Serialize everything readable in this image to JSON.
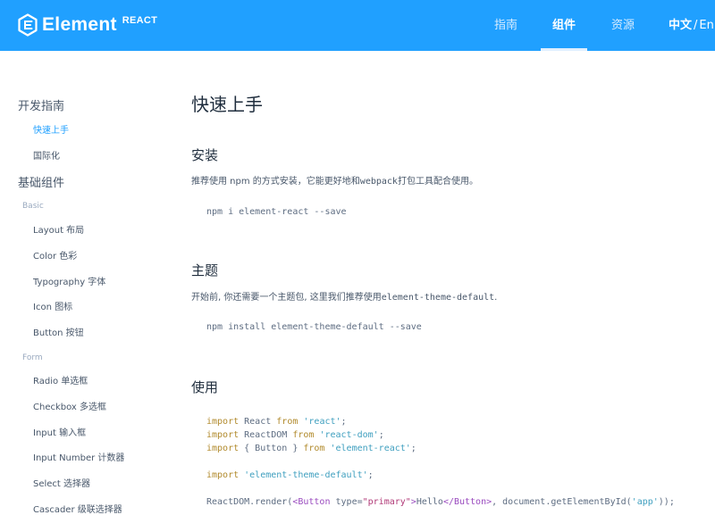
{
  "header": {
    "logo_text": "Element",
    "logo_sup": "REACT",
    "nav": [
      "指南",
      "组件",
      "资源"
    ],
    "active_nav": "组件",
    "lang_current": "中文",
    "lang_sep": "/",
    "lang_other": "En",
    "brand_color": "#20a0ff"
  },
  "sidebar": {
    "groups": [
      {
        "title": "开发指南",
        "items": [
          "快速上手",
          "国际化"
        ]
      },
      {
        "title": "基础组件",
        "subgroups": [
          {
            "title": "Basic",
            "items": [
              "Layout 布局",
              "Color 色彩",
              "Typography 字体",
              "Icon 图标",
              "Button 按钮"
            ]
          },
          {
            "title": "Form",
            "items": [
              "Radio 单选框",
              "Checkbox 多选框",
              "Input 输入框",
              "Input Number 计数器",
              "Select 选择器",
              "Cascader 级联选择器"
            ]
          }
        ]
      }
    ],
    "active_item": "快速上手",
    "active_color": "#20a0ff"
  },
  "content": {
    "title": "快速上手",
    "install": {
      "heading": "安装",
      "desc_a": "推荐使用 npm 的方式安装，它能更好地和",
      "desc_code": "webpack",
      "desc_b": "打包工具配合使用。",
      "command": "npm i element-react --save"
    },
    "theme": {
      "heading": "主题",
      "desc_a": "开始前, 你还需要一个主题包, 这里我们推荐使用",
      "desc_code": "element-theme-default",
      "desc_b": ".",
      "command": "npm install element-theme-default --save"
    },
    "usage": {
      "heading": "使用",
      "line1": {
        "kw1": "import",
        "name": " React ",
        "kw2": "from",
        "str": " 'react'",
        "end": ";"
      },
      "line2": {
        "kw1": "import",
        "name": " ReactDOM ",
        "kw2": "from",
        "str": " 'react-dom'",
        "end": ";"
      },
      "line3": {
        "kw1": "import",
        "name": " { Button } ",
        "kw2": "from",
        "str": " 'element-react'",
        "end": ";"
      },
      "line4": {
        "kw1": "import",
        "str": " 'element-theme-default'",
        "end": ";"
      },
      "line5": {
        "a": "ReactDOM.render(",
        "t1": "<Button",
        "b": " type=",
        "v": "\"primary\"",
        "t2": ">",
        "c": "Hello",
        "t3": "</Button>",
        "d": ", document.getElementById(",
        "s": "'app'",
        "e": "));"
      }
    }
  }
}
